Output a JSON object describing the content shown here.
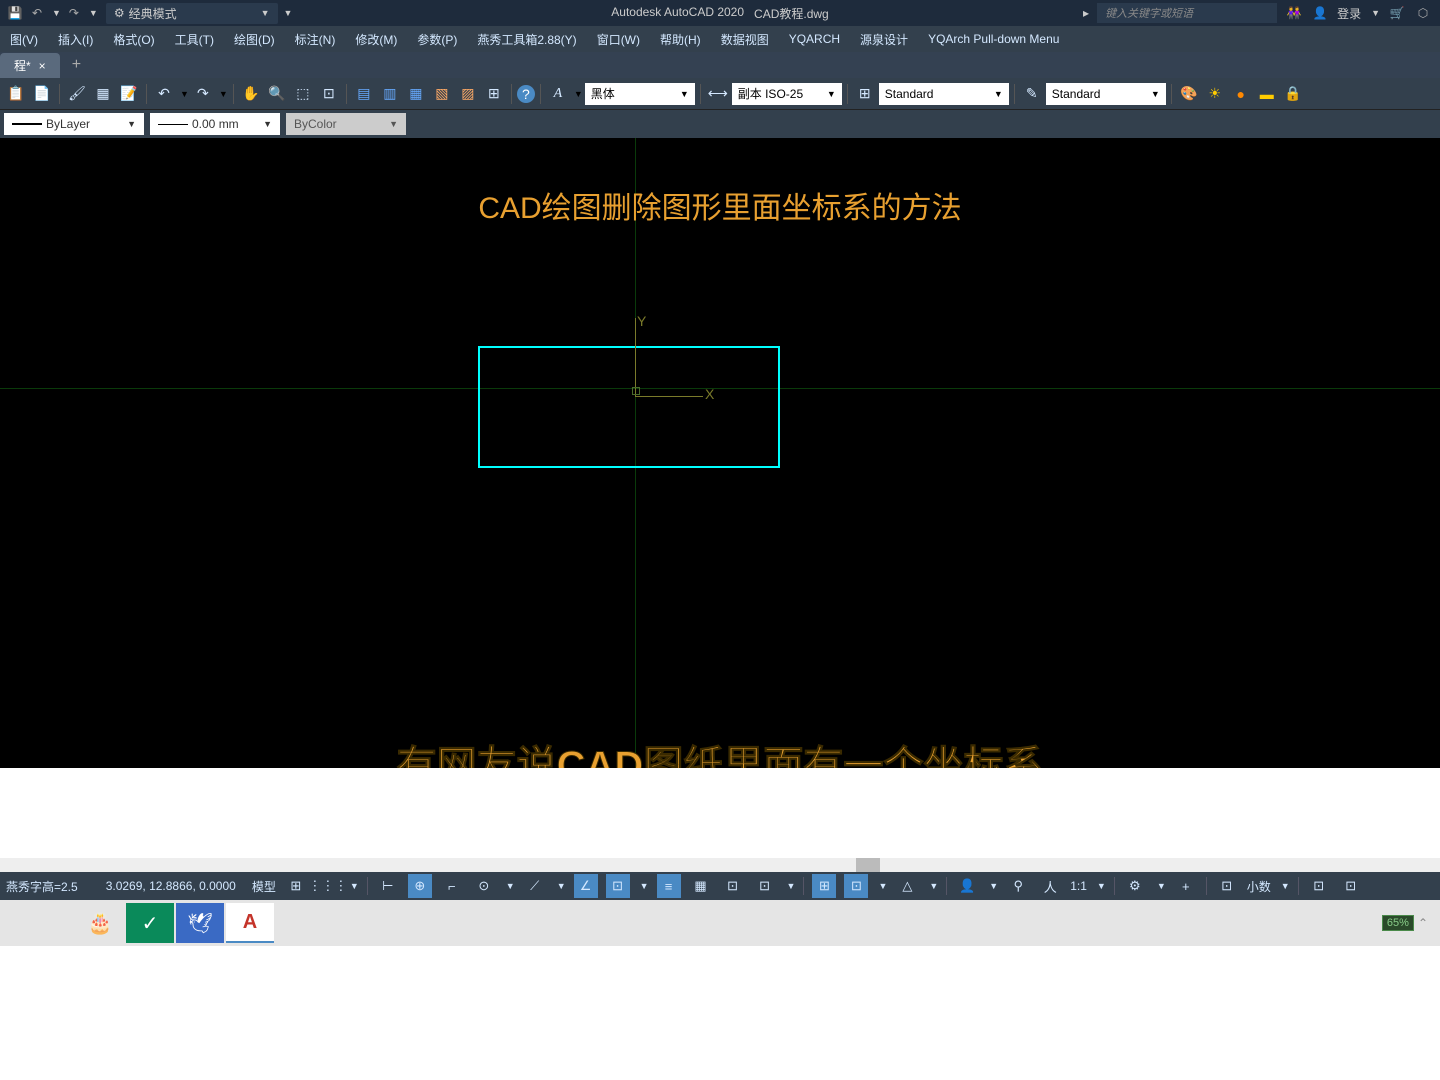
{
  "titlebar": {
    "workspace": "经典模式",
    "app": "Autodesk AutoCAD 2020",
    "filename": "CAD教程.dwg",
    "search_placeholder": "键入关键字或短语",
    "login": "登录"
  },
  "menubar": {
    "items": [
      "图(V)",
      "插入(I)",
      "格式(O)",
      "工具(T)",
      "绘图(D)",
      "标注(N)",
      "修改(M)",
      "参数(P)",
      "燕秀工具箱2.88(Y)",
      "窗口(W)",
      "帮助(H)",
      "数据视图",
      "YQARCH",
      "源泉设计",
      "YQArch Pull-down Menu"
    ]
  },
  "tabs": {
    "active": "程*",
    "close": "×",
    "new": "+"
  },
  "toolbar1": {
    "font": "黑体",
    "dimstyle": "副本 ISO-25",
    "textstyle": "Standard",
    "tablestyle": "Standard"
  },
  "toolbar2": {
    "layer": "ByLayer",
    "lineweight": "0.00 mm",
    "color": "ByColor"
  },
  "canvas": {
    "title": "CAD绘图删除图形里面坐标系的方法",
    "subtitle": "有网友说CAD图纸里面有一个坐标系",
    "ucs_y": "Y",
    "ucs_x": "X"
  },
  "statusbar": {
    "text_height": "燕秀字高=2.5",
    "coords": "3.0269, 12.8866, 0.0000",
    "model": "模型",
    "scale": "1:1",
    "decimal": "小数",
    "zoom": "65%"
  }
}
